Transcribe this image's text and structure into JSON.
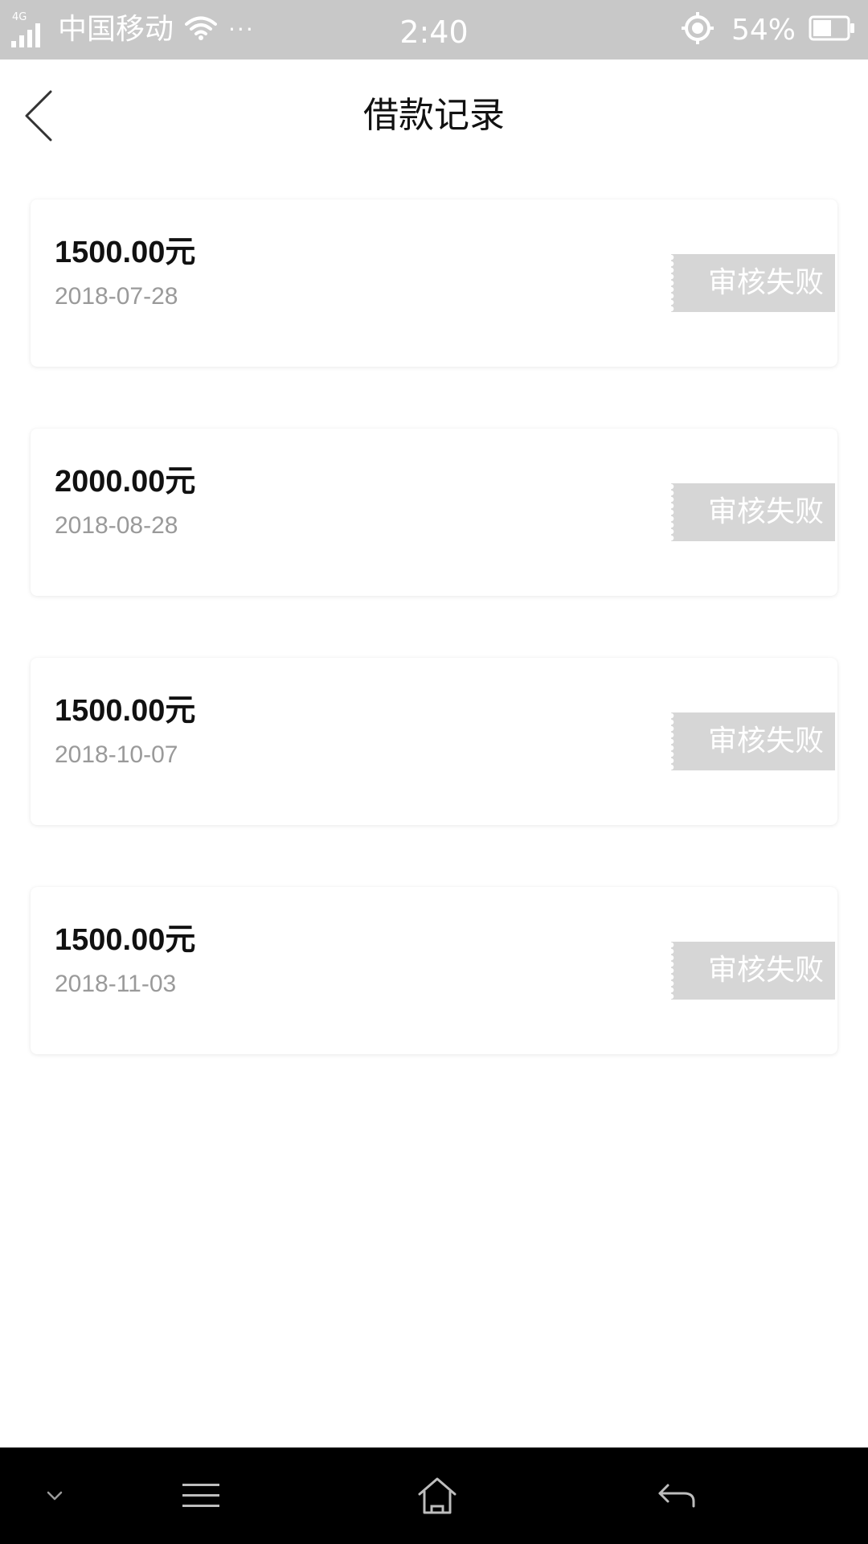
{
  "status_bar": {
    "network": "4G",
    "carrier": "中国移动",
    "more": "···",
    "time": "2:40",
    "battery": "54%"
  },
  "header": {
    "title": "借款记录"
  },
  "records": [
    {
      "amount": "1500.00元",
      "date": "2018-07-28",
      "status": "审核失败"
    },
    {
      "amount": "2000.00元",
      "date": "2018-08-28",
      "status": "审核失败"
    },
    {
      "amount": "1500.00元",
      "date": "2018-10-07",
      "status": "审核失败"
    },
    {
      "amount": "1500.00元",
      "date": "2018-11-03",
      "status": "审核失败"
    }
  ],
  "icons": {
    "back": "back-arrow-icon",
    "signal": "signal-icon",
    "wifi": "wifi-icon",
    "location": "location-icon",
    "battery": "battery-icon",
    "collapse": "chevron-down-icon",
    "menu": "menu-icon",
    "home": "home-icon",
    "return": "return-icon"
  },
  "colors": {
    "status_bar_bg": "#c8c8c8",
    "badge_bg": "#d6d6d6",
    "date_text": "#9a9a9a",
    "system_nav_bg": "#000000"
  }
}
